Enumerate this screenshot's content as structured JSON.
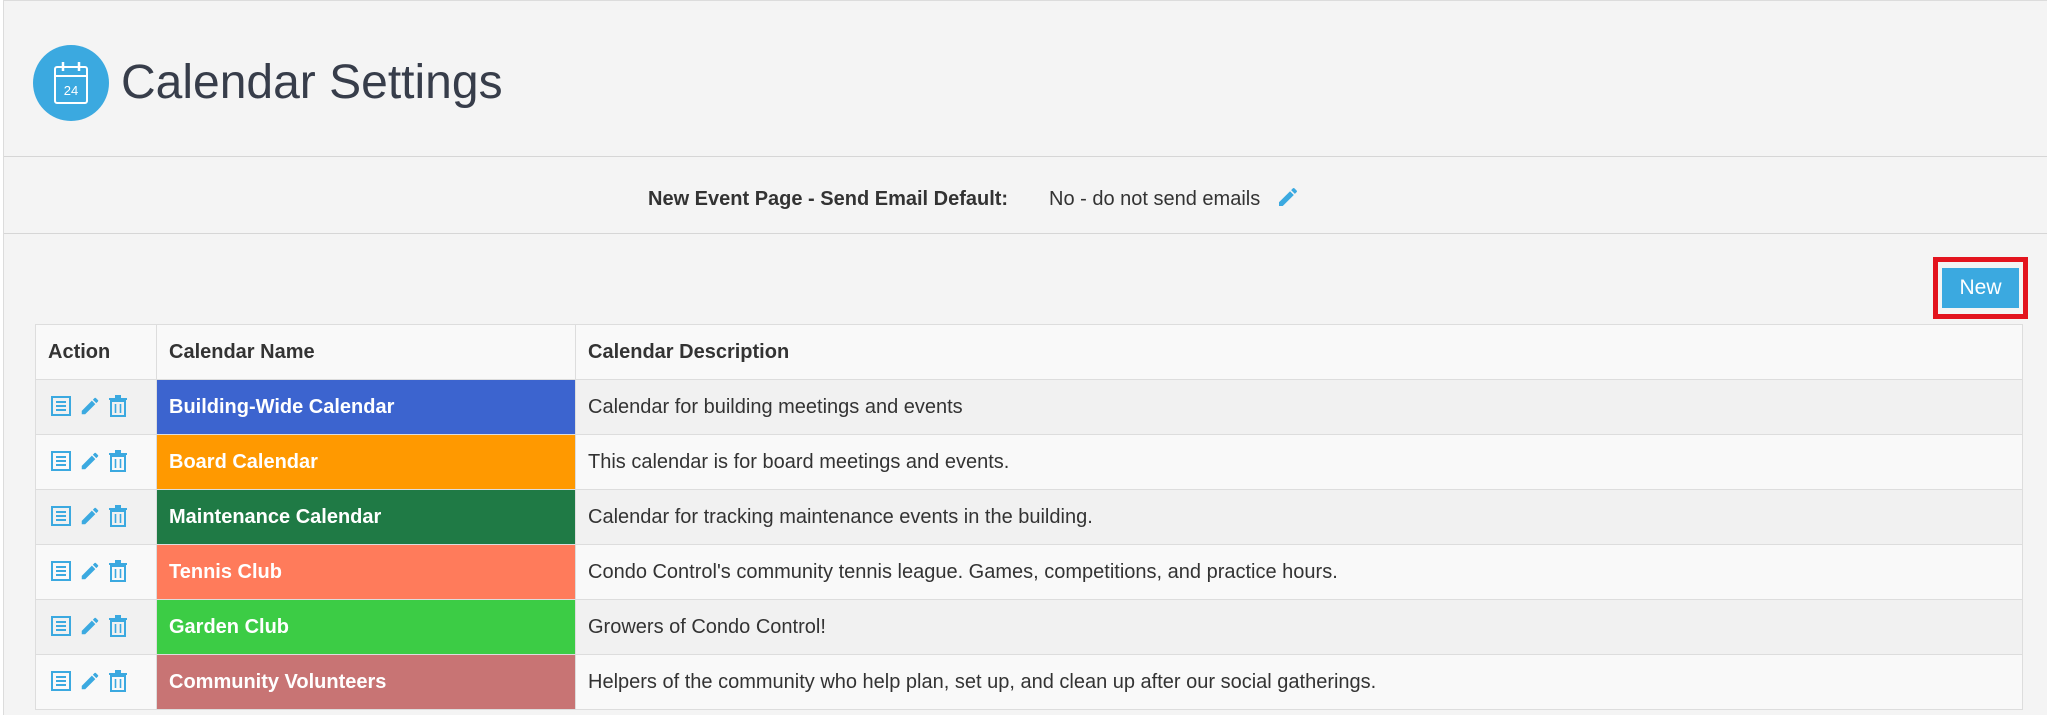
{
  "page": {
    "title": "Calendar Settings",
    "badge_day": "24"
  },
  "email_default": {
    "label": "New Event Page - Send Email Default:",
    "value": "No - do not send emails"
  },
  "toolbar": {
    "new_label": "New"
  },
  "table": {
    "headers": [
      "Action",
      "Calendar Name",
      "Calendar Description"
    ],
    "rows": [
      {
        "name": "Building-Wide Calendar",
        "description": "Calendar for building meetings and events",
        "color": "#3c64cf"
      },
      {
        "name": "Board Calendar",
        "description": "This calendar is for board meetings and events.",
        "color": "#ff9900"
      },
      {
        "name": "Maintenance Calendar",
        "description": "Calendar for tracking maintenance events in the building.",
        "color": "#1f7a45"
      },
      {
        "name": "Tennis Club",
        "description": "Condo Control's community tennis league. Games, competitions, and practice hours.",
        "color": "#ff7b5b"
      },
      {
        "name": "Garden Club",
        "description": "Growers of Condo Control!",
        "color": "#3ccc45"
      },
      {
        "name": "Community Volunteers",
        "description": "Helpers of the community who help plan, set up, and clean up after our social gatherings.",
        "color": "#c87474"
      }
    ]
  },
  "icons": {
    "view": "list-icon",
    "edit": "pencil-icon",
    "delete": "trash-icon"
  },
  "colors": {
    "accent": "#3ba9e0",
    "highlight": "#e3141e"
  }
}
